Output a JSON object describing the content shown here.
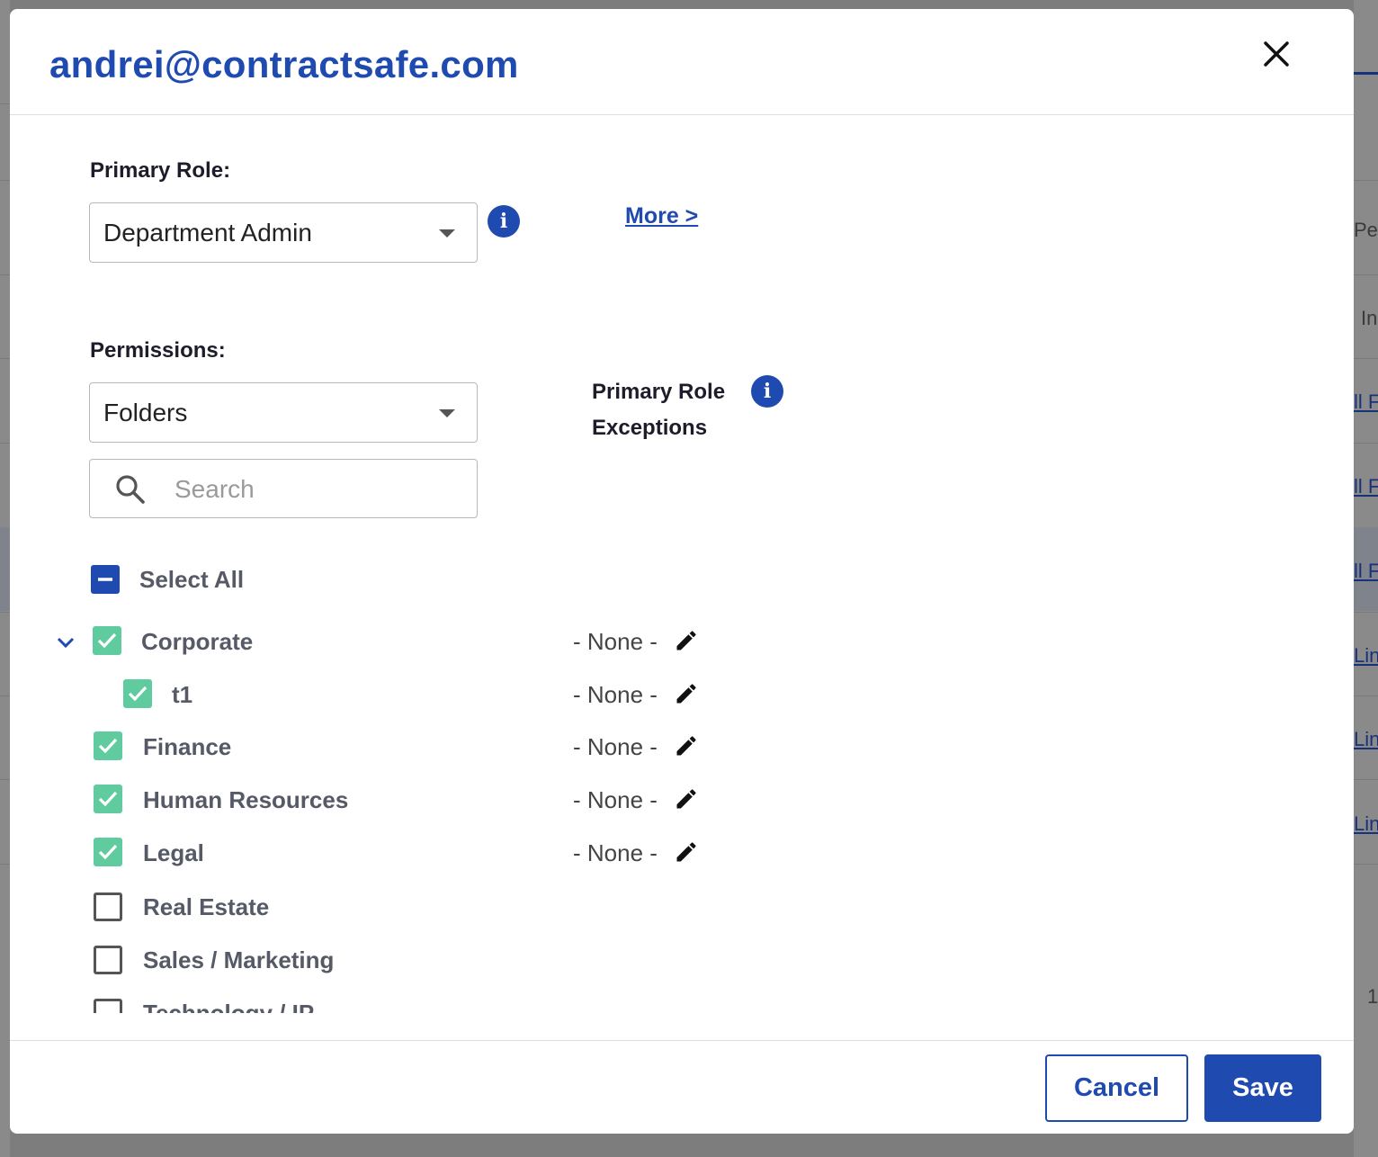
{
  "modal": {
    "title": "andrei@contractsafe.com",
    "primary_role_label": "Primary Role:",
    "primary_role_value": "Department Admin",
    "more_link": "More >",
    "permissions_label": "Permissions:",
    "permissions_value": "Folders",
    "search_placeholder": "Search",
    "exceptions_label_line1": "Primary Role",
    "exceptions_label_line2": "Exceptions",
    "select_all_label": "Select All",
    "select_all_state": "indeterminate",
    "items": [
      {
        "label": "Corporate",
        "checked": true,
        "exception": "- None -",
        "expanded": true
      },
      {
        "label": "t1",
        "checked": true,
        "exception": "- None -"
      },
      {
        "label": "Finance",
        "checked": true,
        "exception": "- None -"
      },
      {
        "label": "Human Resources",
        "checked": true,
        "exception": "- None -"
      },
      {
        "label": "Legal",
        "checked": true,
        "exception": "- None -"
      },
      {
        "label": "Real Estate",
        "checked": false
      },
      {
        "label": "Sales / Marketing",
        "checked": false
      },
      {
        "label": "Technology / IP",
        "checked": false
      }
    ],
    "cancel_label": "Cancel",
    "save_label": "Save"
  },
  "background": {
    "fragments": [
      "Pe",
      "In",
      "ll F",
      "ll F",
      "ll F",
      "Lin",
      "Lin",
      "Lin",
      "1"
    ]
  },
  "colors": {
    "primary": "#1f4bb0",
    "checked": "#5fcb9e",
    "overlay": "#7d7d7d"
  }
}
